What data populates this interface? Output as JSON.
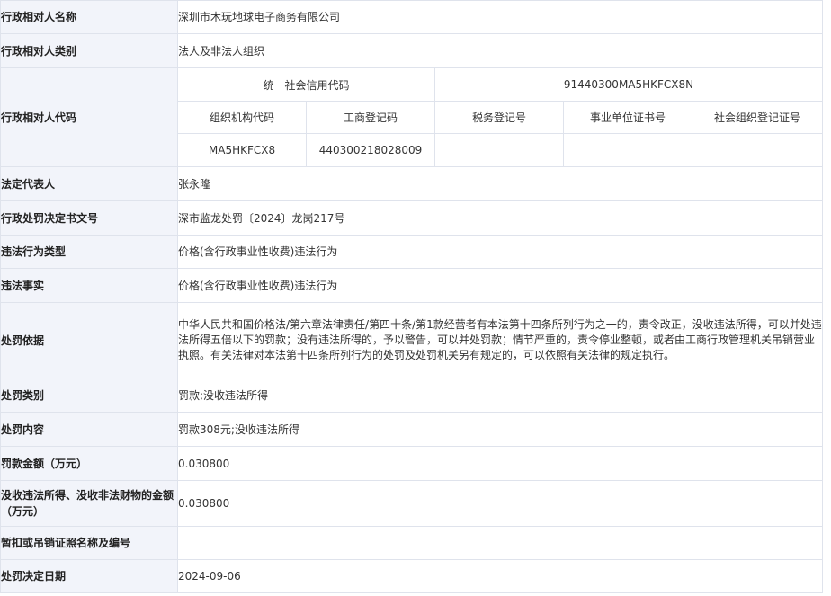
{
  "rows": {
    "name": {
      "label": "行政相对人名称",
      "value": "深圳市木玩地球电子商务有限公司"
    },
    "category": {
      "label": "行政相对人类别",
      "value": "法人及非法人组织"
    },
    "code": {
      "label": "行政相对人代码",
      "credit_code_label": "统一社会信用代码",
      "credit_code_value": "91440300MA5HKFCX8N",
      "sub_headers": [
        "组织机构代码",
        "工商登记码",
        "税务登记号",
        "事业单位证书号",
        "社会组织登记证号"
      ],
      "sub_values": [
        "MA5HKFCX8",
        "440300218028009",
        "",
        "",
        ""
      ]
    },
    "legal_rep": {
      "label": "法定代表人",
      "value": "张永隆"
    },
    "doc_no": {
      "label": "行政处罚决定书文号",
      "value": "深市监龙处罚〔2024〕龙岗217号"
    },
    "violation_type": {
      "label": "违法行为类型",
      "value": "价格(含行政事业性收费)违法行为"
    },
    "violation_fact": {
      "label": "违法事实",
      "value": "价格(含行政事业性收费)违法行为"
    },
    "basis": {
      "label": "处罚依据",
      "value": "中华人民共和国价格法/第六章法律责任/第四十条/第1款经营者有本法第十四条所列行为之一的，责令改正，没收违法所得，可以并处违法所得五倍以下的罚款；没有违法所得的，予以警告，可以并处罚款；情节严重的，责令停业整顿，或者由工商行政管理机关吊销营业执照。有关法律对本法第十四条所列行为的处罚及处罚机关另有规定的，可以依照有关法律的规定执行。"
    },
    "penalty_category": {
      "label": "处罚类别",
      "value": "罚款;没收违法所得"
    },
    "penalty_content": {
      "label": "处罚内容",
      "value": "罚款308元;没收违法所得"
    },
    "fine_amount": {
      "label": "罚款金额（万元）",
      "value": "0.030800"
    },
    "confiscation": {
      "label": "没收违法所得、没收非法财物的金额（万元）",
      "value": "0.030800"
    },
    "license": {
      "label": "暂扣或吊销证照名称及编号",
      "value": ""
    },
    "decision_date": {
      "label": "处罚决定日期",
      "value": "2024-09-06"
    }
  }
}
